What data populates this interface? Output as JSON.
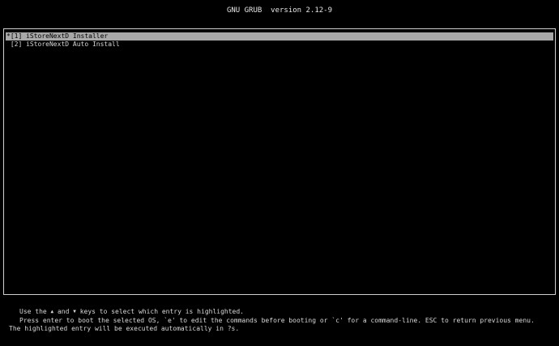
{
  "header": {
    "title": "GNU GRUB  version 2.12-9"
  },
  "menu": {
    "entries": [
      {
        "marker": "*",
        "label": "[1] iStoreNextD Installer",
        "selected": true
      },
      {
        "marker": " ",
        "label": "[2] iStoreNextD Auto Install",
        "selected": false
      }
    ]
  },
  "help": {
    "line1_prefix": "Use the ",
    "up_arrow": "▲",
    "line1_mid": " and ",
    "down_arrow": "▼",
    "line1_suffix": " keys to select which entry is highlighted.",
    "line2": "Press enter to boot the selected OS, `e' to edit the commands before booting or `c' for a command-line. ESC to return previous menu.",
    "line3": "The highlighted entry will be executed automatically in ?s."
  }
}
